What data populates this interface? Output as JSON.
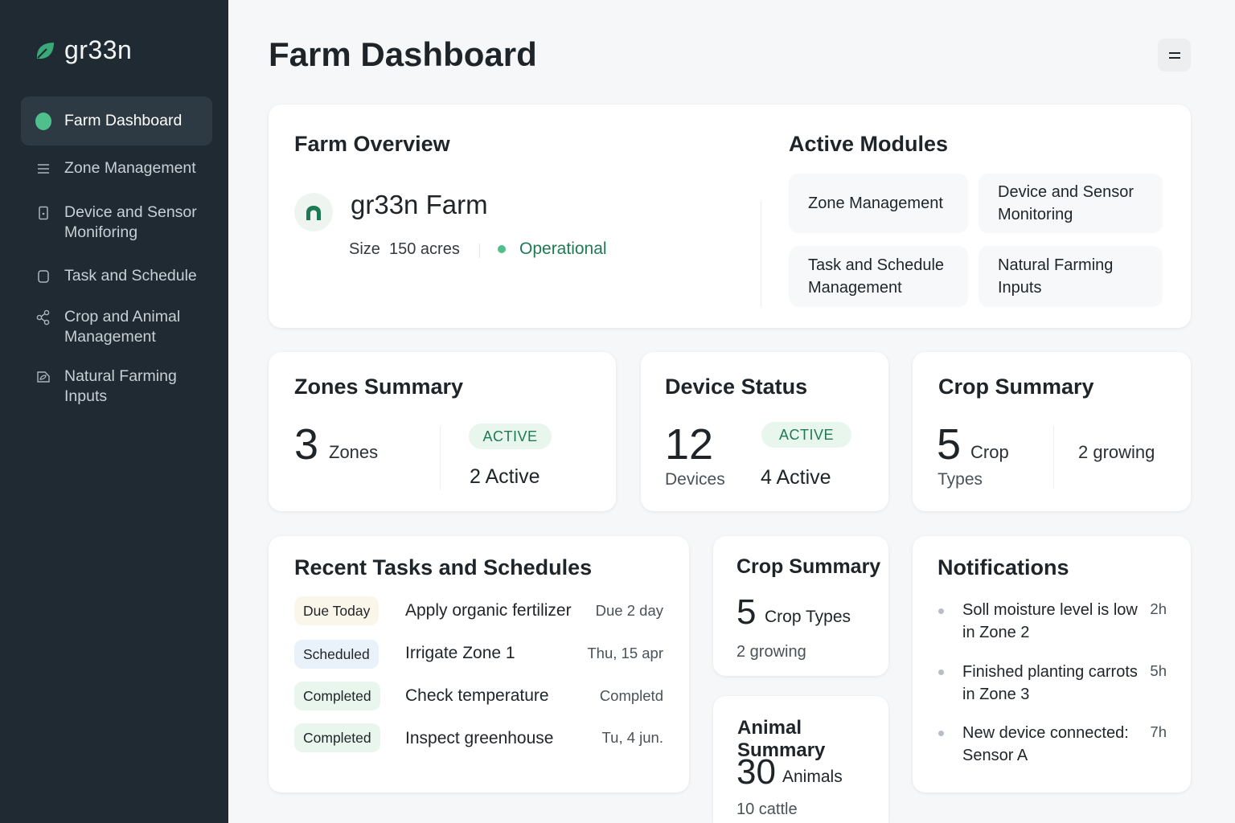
{
  "app": {
    "brand": "gr33n",
    "page_title": "Farm Dashboard",
    "accent": "#4fbf8b",
    "sidebar_bg": "#1f2a33"
  },
  "sidebar": {
    "items": [
      {
        "label": "Farm Dashboard",
        "icon": "active-dot-icon",
        "active": true
      },
      {
        "label": "Zone Management",
        "icon": "list-icon"
      },
      {
        "label": "Device and Sensor Moniforing",
        "icon": "device-icon"
      },
      {
        "label": "Task and Schedule",
        "icon": "calendar-icon"
      },
      {
        "label": "Crop and Animal Management",
        "icon": "share-nodes-icon"
      },
      {
        "label": "Natural Farming Inputs",
        "icon": "leaf-tag-icon"
      }
    ]
  },
  "overview": {
    "title": "Farm Overview",
    "farm_name": "gr33n Farm",
    "size_label": "Size",
    "size_value": "150 acres",
    "status": "Operational",
    "status_color": "#1e7a55"
  },
  "modules": {
    "title": "Active Modules",
    "items": [
      "Zone Management",
      "Device and Sensor Monitoring",
      "Task and Schedule Management",
      "Natural Farming Inputs"
    ]
  },
  "zones_summary": {
    "title": "Zones Summary",
    "count": "3",
    "unit": "Zones",
    "badge": "ACTIVE",
    "active": "2 Active"
  },
  "device_status": {
    "title": "Device Status",
    "count": "12",
    "unit": "Devices",
    "badge": "ACTIVE",
    "active": "4 Active"
  },
  "crop_summary": {
    "title": "Crop Summary",
    "count": "5",
    "unit_1": "Crop",
    "unit_2": "Types",
    "growing": "2 growing"
  },
  "tasks": {
    "title": "Recent Tasks and Schedules",
    "rows": [
      {
        "badge": "Due Today",
        "name": "Apply organic fertilizer",
        "date": "Due 2 day"
      },
      {
        "badge": "Scheduled",
        "name": "Irrigate Zone 1",
        "date": "Thu, 15 apr"
      },
      {
        "badge": "Completed",
        "name": "Check temperature",
        "date": "Completd"
      },
      {
        "badge": "Completed",
        "name": "Inspect greenhouse",
        "date": "Tu, 4 jun."
      }
    ]
  },
  "crop_summary_small": {
    "title": "Crop Summary",
    "count": "5",
    "unit": "Crop Types",
    "growing": "2 growing"
  },
  "animal_summary": {
    "title": "Animal Summary",
    "count": "30",
    "unit": "Animals",
    "detail": "10 cattle"
  },
  "notifications": {
    "title": "Notifications",
    "items": [
      {
        "text": "Soll moisture level is low in Zone 2",
        "time": "2h"
      },
      {
        "text": "Finished planting carrots in Zone 3",
        "time": "5h"
      },
      {
        "text": "New device connected: Sensor A",
        "time": "7h"
      }
    ]
  }
}
